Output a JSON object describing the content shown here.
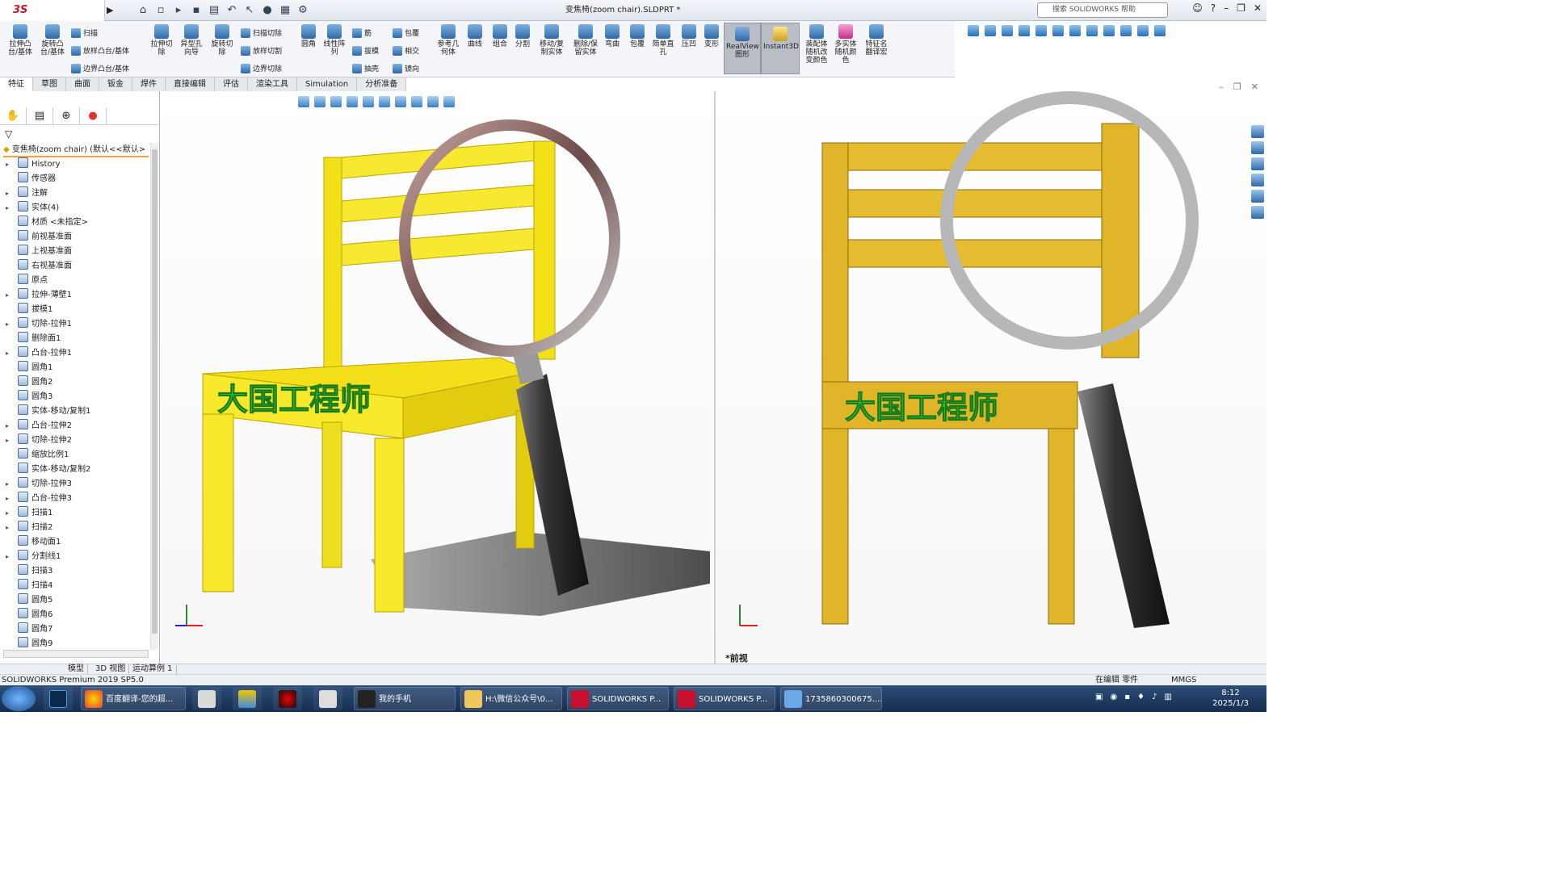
{
  "app": {
    "logo_text": "3S SOLIDWORKS",
    "doc_title": "变焦椅(zoom chair).SLDPRT *",
    "search_placeholder": "搜索 SOLIDWORKS 帮助",
    "colors": {
      "accent": "#c8102e",
      "chair": "#f7e12a",
      "text_green": "#3cc93c"
    }
  },
  "ribbon": {
    "buttons": [
      {
        "id": "extrude-boss",
        "label": "拉伸凸台/基体"
      },
      {
        "id": "revolve-boss",
        "label": "旋转凸台/基体"
      },
      {
        "id": "sweep",
        "label": "扫描"
      },
      {
        "id": "loft-boss",
        "label": "放样凸台/基体"
      },
      {
        "id": "boundary-boss",
        "label": "边界凸台/基体"
      },
      {
        "id": "extrude-cut",
        "label": "拉伸切除"
      },
      {
        "id": "hole-wizard",
        "label": "异型孔向导"
      },
      {
        "id": "revolve-cut",
        "label": "旋转切除"
      },
      {
        "id": "swept-cut",
        "label": "扫描切除"
      },
      {
        "id": "lofted-cut",
        "label": "放样切割"
      },
      {
        "id": "boundary-cut",
        "label": "边界切除"
      },
      {
        "id": "fillet",
        "label": "圆角"
      },
      {
        "id": "linear-pattern",
        "label": "线性阵列"
      },
      {
        "id": "rib",
        "label": "筋"
      },
      {
        "id": "draft",
        "label": "拔模"
      },
      {
        "id": "shell",
        "label": "抽壳"
      },
      {
        "id": "wrap",
        "label": "包覆"
      },
      {
        "id": "intersect",
        "label": "相交"
      },
      {
        "id": "mirror",
        "label": "镜向"
      },
      {
        "id": "ref-geom",
        "label": "参考几何体"
      },
      {
        "id": "curves",
        "label": "曲线"
      },
      {
        "id": "combine",
        "label": "组合"
      },
      {
        "id": "split",
        "label": "分割"
      },
      {
        "id": "move-copy",
        "label": "移动/复制实体"
      },
      {
        "id": "delete-keep",
        "label": "删除/保留实体"
      },
      {
        "id": "flex",
        "label": "弯曲"
      },
      {
        "id": "wrap2",
        "label": "包覆"
      },
      {
        "id": "simple-hole",
        "label": "简单直孔"
      },
      {
        "id": "indent",
        "label": "压凹"
      },
      {
        "id": "deform",
        "label": "变形"
      },
      {
        "id": "realview",
        "label": "RealView图形"
      },
      {
        "id": "instant3d",
        "label": "Instant3D"
      },
      {
        "id": "assembly-color",
        "label": "装配体随机改变颜色"
      },
      {
        "id": "multibody-color",
        "label": "多实体随机颜色"
      },
      {
        "id": "feature-translate",
        "label": "特征名翻译宏"
      }
    ]
  },
  "tabs": [
    "特征",
    "草图",
    "曲面",
    "钣金",
    "焊件",
    "直接编辑",
    "评估",
    "渲染工具",
    "Simulation",
    "分析准备"
  ],
  "tree": {
    "root": "变焦椅(zoom chair)  (默认<<默认>",
    "items": [
      "History",
      "传感器",
      "注解",
      "实体(4)",
      "材质 <未指定>",
      "前视基准面",
      "上视基准面",
      "右视基准面",
      "原点",
      "拉伸-薄壁1",
      "拔模1",
      "切除-拉伸1",
      "删除面1",
      "凸台-拉伸1",
      "圆角1",
      "圆角2",
      "圆角3",
      "实体-移动/复制1",
      "凸台-拉伸2",
      "切除-拉伸2",
      "缩放比例1",
      "实体-移动/复制2",
      "切除-拉伸3",
      "凸台-拉伸3",
      "扫描1",
      "扫描2",
      "移动面1",
      "分割线1",
      "扫描3",
      "扫描4",
      "圆角5",
      "圆角6",
      "圆角7",
      "圆角9"
    ]
  },
  "viewport": {
    "chair_text": "大国工程师",
    "right_view_label": "*前视"
  },
  "bottom_tabs": [
    "模型",
    "3D 视图",
    "运动算例 1"
  ],
  "status": {
    "product": "SOLIDWORKS Premium 2019 SP5.0",
    "mode": "在编辑 零件",
    "units": "MMGS"
  },
  "taskbar": {
    "items": [
      "百度翻译-您的超...",
      "我的手机",
      "H:\\微信公众号\\0...",
      "SOLIDWORKS P...",
      "SOLIDWORKS P...",
      "1735860300675...."
    ],
    "time": "8:12",
    "date": "2025/1/3"
  }
}
